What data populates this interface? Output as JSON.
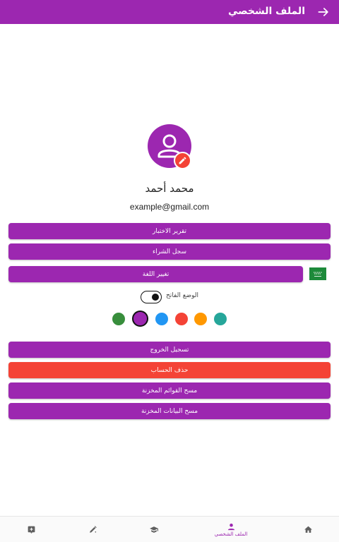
{
  "header": {
    "title": "الملف الشخصي",
    "back_icon": "arrow-forward-icon"
  },
  "profile": {
    "name": "محمد أحمد",
    "email": "example@gmail.com"
  },
  "buttons": {
    "quiz_report": "تقرير الاختبار",
    "purchase_history": "سجل الشراء",
    "change_language": "تغيير اللغة",
    "logout": "تسجيل الخروج",
    "delete_account": "حذف الحساب",
    "clear_saved_lists": "مسح القوائم المخزنة",
    "clear_saved_data": "مسح البيانات المخزنة"
  },
  "theme": {
    "light_mode_label": "الوضع الفاتح",
    "toggle_on": true
  },
  "colors": {
    "accent": "#9c27b0",
    "danger": "#f44336",
    "swatches": [
      "#388e3c",
      "#9c27b0",
      "#2196f3",
      "#f44336",
      "#ff9800",
      "#26a69a"
    ],
    "selected_swatch": "#9c27b0"
  },
  "bottom_nav": {
    "items": [
      {
        "icon": "add-box-icon",
        "label": ""
      },
      {
        "icon": "edit-note-icon",
        "label": ""
      },
      {
        "icon": "school-icon",
        "label": ""
      },
      {
        "icon": "person-icon",
        "label": "الملف الشخصي",
        "active": true
      },
      {
        "icon": "home-icon",
        "label": ""
      }
    ]
  }
}
